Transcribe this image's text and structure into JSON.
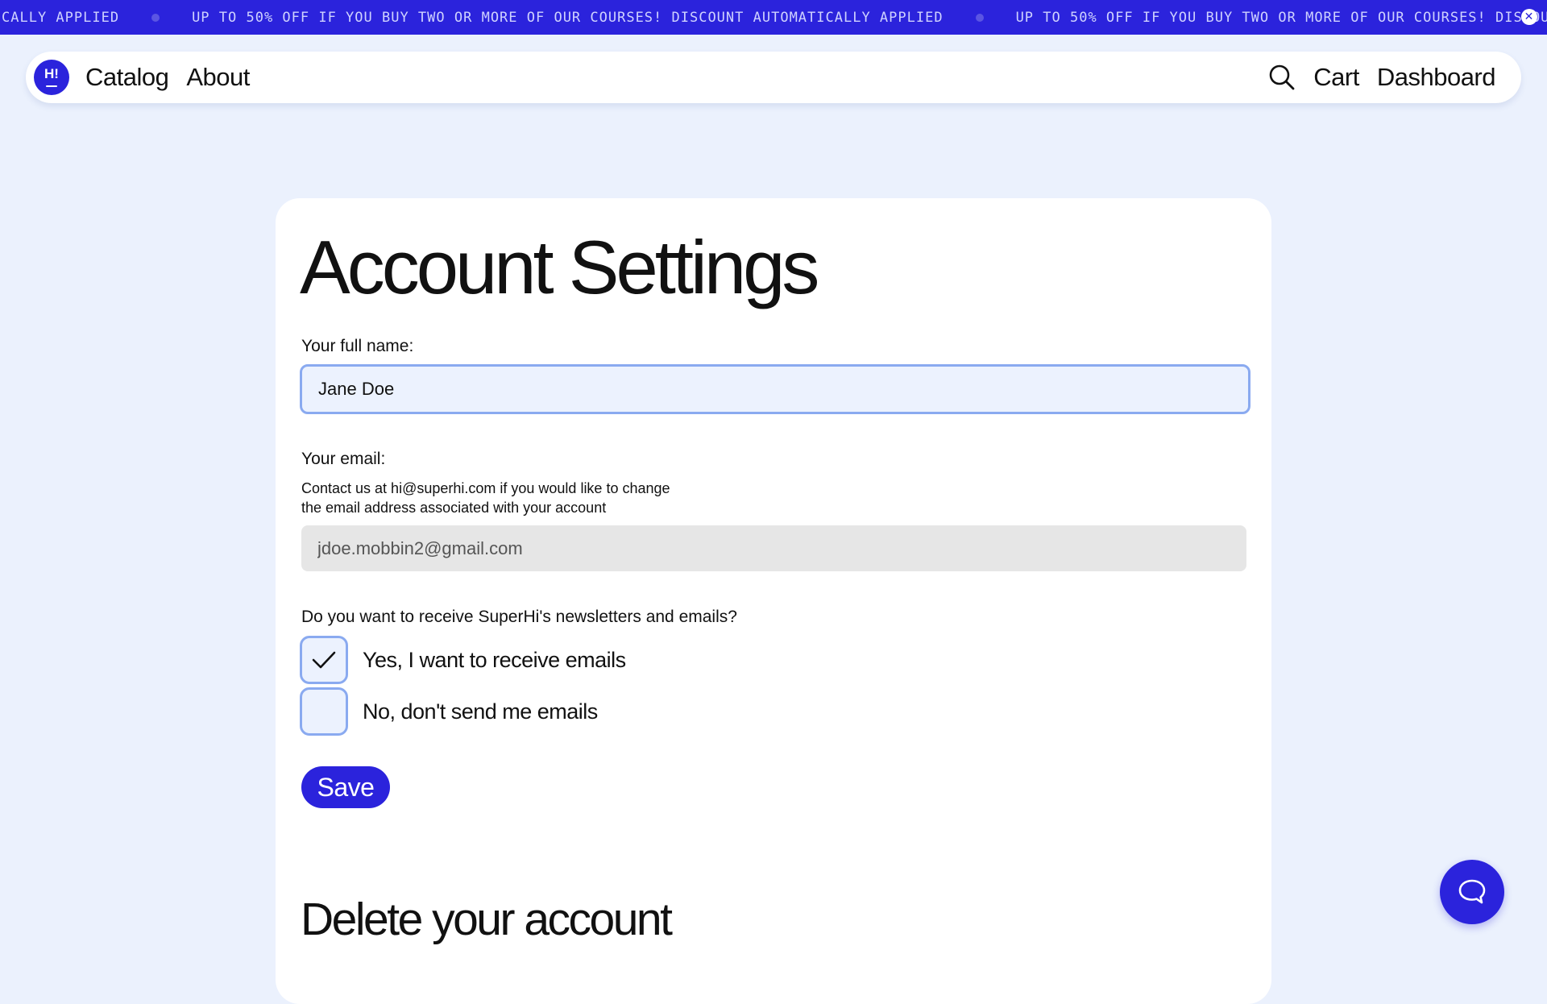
{
  "banner": {
    "segments": [
      "CALLY APPLIED",
      "UP TO 50% OFF IF YOU BUY TWO OR MORE OF OUR COURSES! DISCOUNT AUTOMATICALLY APPLIED",
      "UP TO 50% OFF IF YOU BUY TWO OR MORE OF OUR COURSES! DISCOUNT AU"
    ],
    "close_icon": "close-icon"
  },
  "nav": {
    "logo_text": "H!",
    "catalog": "Catalog",
    "about": "About",
    "cart": "Cart",
    "dashboard": "Dashboard",
    "search_icon": "search-icon"
  },
  "settings": {
    "title": "Account Settings",
    "name_label": "Your full name:",
    "name_value": "Jane Doe",
    "email_label": "Your email:",
    "email_help_line1": "Contact us at hi@superhi.com if you would like to change",
    "email_help_line2": "the email address associated with your account",
    "email_value": "jdoe.mobbin2@gmail.com",
    "newsletter_question": "Do you want to receive SuperHi's newsletters and emails?",
    "option_yes": "Yes, I want to receive emails",
    "option_no": "No, don't send me emails",
    "option_yes_checked": true,
    "option_no_checked": false,
    "save_label": "Save",
    "delete_title": "Delete your account"
  },
  "chat": {
    "icon": "chat-bubble-icon"
  },
  "colors": {
    "brand": "#2b23dc",
    "background": "#ebf1fd",
    "input_border": "#8aaaf0"
  }
}
